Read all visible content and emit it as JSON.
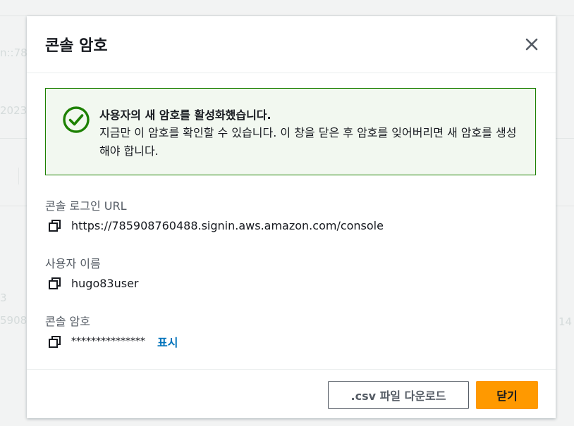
{
  "background": {
    "fragments": [
      "n::785",
      "2023",
      "3",
      "5908",
      "14"
    ]
  },
  "modal": {
    "title": "콘솔 암호",
    "close_icon": "close-icon"
  },
  "alert": {
    "status": "success",
    "icon": "check-circle-icon",
    "color": "#1d8102",
    "title": "사용자의 새 암호를 활성화했습니다.",
    "body": "지금만 이 암호를 확인할 수 있습니다. 이 창을 닫은 후 암호를 잊어버리면 새 암호를 생성해야 합니다."
  },
  "fields": {
    "login_url": {
      "label": "콘솔 로그인 URL",
      "value": "https://785908760488.signin.aws.amazon.com/console"
    },
    "username": {
      "label": "사용자 이름",
      "value": "hugo83user"
    },
    "password": {
      "label": "콘솔 암호",
      "value": "***************",
      "show_label": "표시"
    }
  },
  "footer": {
    "csv_label": ".csv 파일 다운로드",
    "close_label": "닫기"
  },
  "colors": {
    "primary_button": "#ff9900",
    "link": "#0073bb",
    "success": "#1d8102"
  }
}
